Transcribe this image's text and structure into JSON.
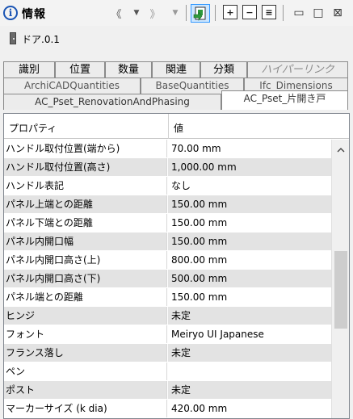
{
  "header": {
    "title": "情報",
    "info_glyph": "i",
    "toolbar": {
      "prev_icon": "chevron-double-left-icon",
      "next_icon": "chevron-double-right-icon",
      "prev_glyph": "《",
      "next_glyph": "》",
      "dropdown_glyph": "▼",
      "expand_glyph": "+",
      "collapse_glyph": "−",
      "list_glyph": "≡",
      "min_glyph": "▭",
      "restore_glyph": "□",
      "close_glyph": "⊠"
    }
  },
  "element": {
    "label": "ドア.0.1"
  },
  "tabs": {
    "row1": [
      "識別",
      "位置",
      "数量",
      "関連",
      "分類",
      "ハイパーリンク"
    ],
    "row2": [
      "ArchiCADQuantities",
      "BaseQuantities",
      "Ifc_Dimensions"
    ],
    "row3": [
      "AC_Pset_RenovationAndPhasing",
      "AC_Pset_片開き戸"
    ]
  },
  "grid": {
    "col_property": "プロパティ",
    "col_value": "値",
    "rows": [
      {
        "k": "ハンドル取付位置(端から)",
        "v": "70.00 mm"
      },
      {
        "k": "ハンドル取付位置(高さ)",
        "v": "1,000.00 mm"
      },
      {
        "k": "ハンドル表記",
        "v": "なし"
      },
      {
        "k": "パネル上端との距離",
        "v": "150.00 mm"
      },
      {
        "k": "パネル下端との距離",
        "v": "150.00 mm"
      },
      {
        "k": "パネル内開口幅",
        "v": "150.00 mm"
      },
      {
        "k": "パネル内開口高さ(上)",
        "v": "800.00 mm"
      },
      {
        "k": "パネル内開口高さ(下)",
        "v": "500.00 mm"
      },
      {
        "k": "パネル端との距離",
        "v": "150.00 mm"
      },
      {
        "k": "ヒンジ",
        "v": "未定"
      },
      {
        "k": "フォント",
        "v": "Meiryo UI Japanese"
      },
      {
        "k": "フランス落し",
        "v": "未定"
      },
      {
        "k": "ペン",
        "v": ""
      },
      {
        "k": "ポスト",
        "v": "未定"
      },
      {
        "k": "マーカーサイズ (k dia)",
        "v": "420.00 mm"
      }
    ]
  }
}
